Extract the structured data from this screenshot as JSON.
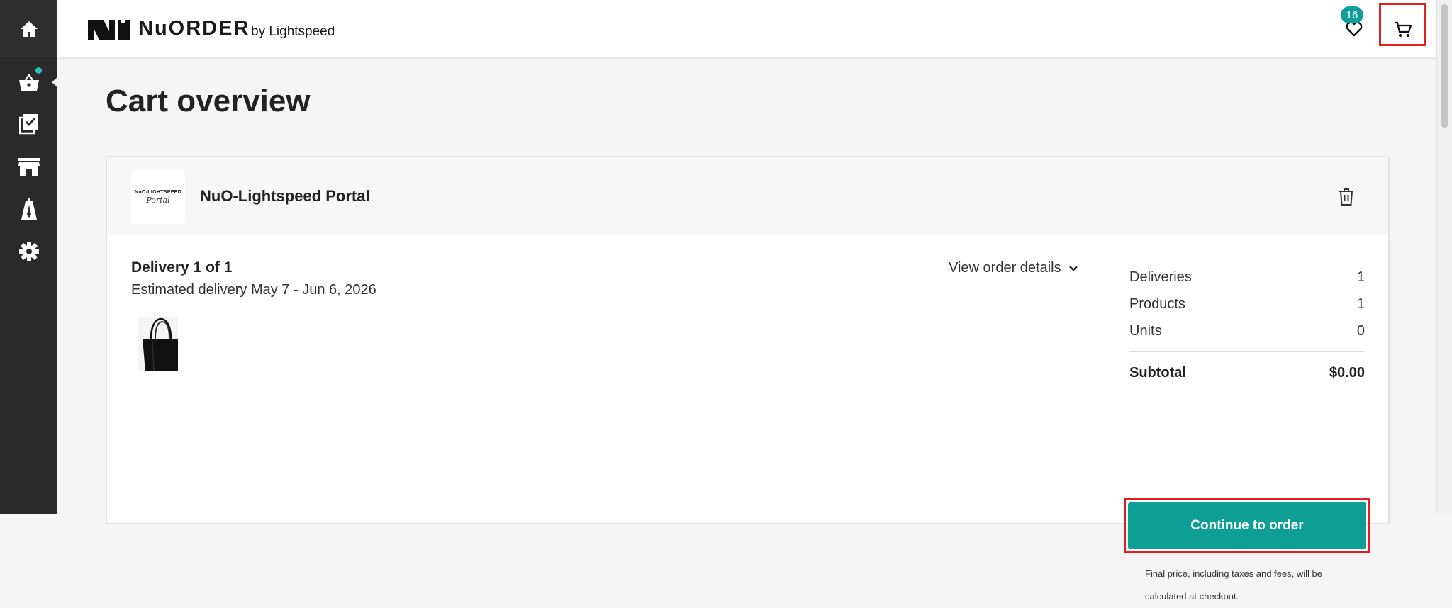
{
  "header": {
    "logo_text": "NuORDER",
    "logo_sub": "by Lightspeed",
    "cart_count": "16"
  },
  "sidebar": {
    "items": [
      {
        "icon": "home-icon"
      },
      {
        "icon": "basket-icon",
        "active": true,
        "notification": true
      },
      {
        "icon": "checklist-icon"
      },
      {
        "icon": "store-icon"
      },
      {
        "icon": "mannequin-icon"
      },
      {
        "icon": "gear-icon"
      }
    ]
  },
  "page": {
    "title": "Cart overview"
  },
  "cart": {
    "brand": {
      "name": "NuO-Lightspeed Portal",
      "logo_line1": "NuO-LIGHTSPEED",
      "logo_line2": "Portal"
    },
    "delivery": {
      "title": "Delivery 1 of 1",
      "estimate": "Estimated delivery May 7 - Jun 6, 2026",
      "view_details": "View order details"
    },
    "summary": {
      "rows": [
        {
          "label": "Deliveries",
          "value": "1"
        },
        {
          "label": "Products",
          "value": "1"
        },
        {
          "label": "Units",
          "value": "0"
        }
      ],
      "subtotal_label": "Subtotal",
      "subtotal_value": "$0.00",
      "continue_label": "Continue to order",
      "note": "Final price, including taxes and fees, will be calculated at checkout."
    }
  },
  "colors": {
    "accent": "#0d9f96",
    "sidebar": "#2a2a2a",
    "highlight": "#e02020"
  }
}
